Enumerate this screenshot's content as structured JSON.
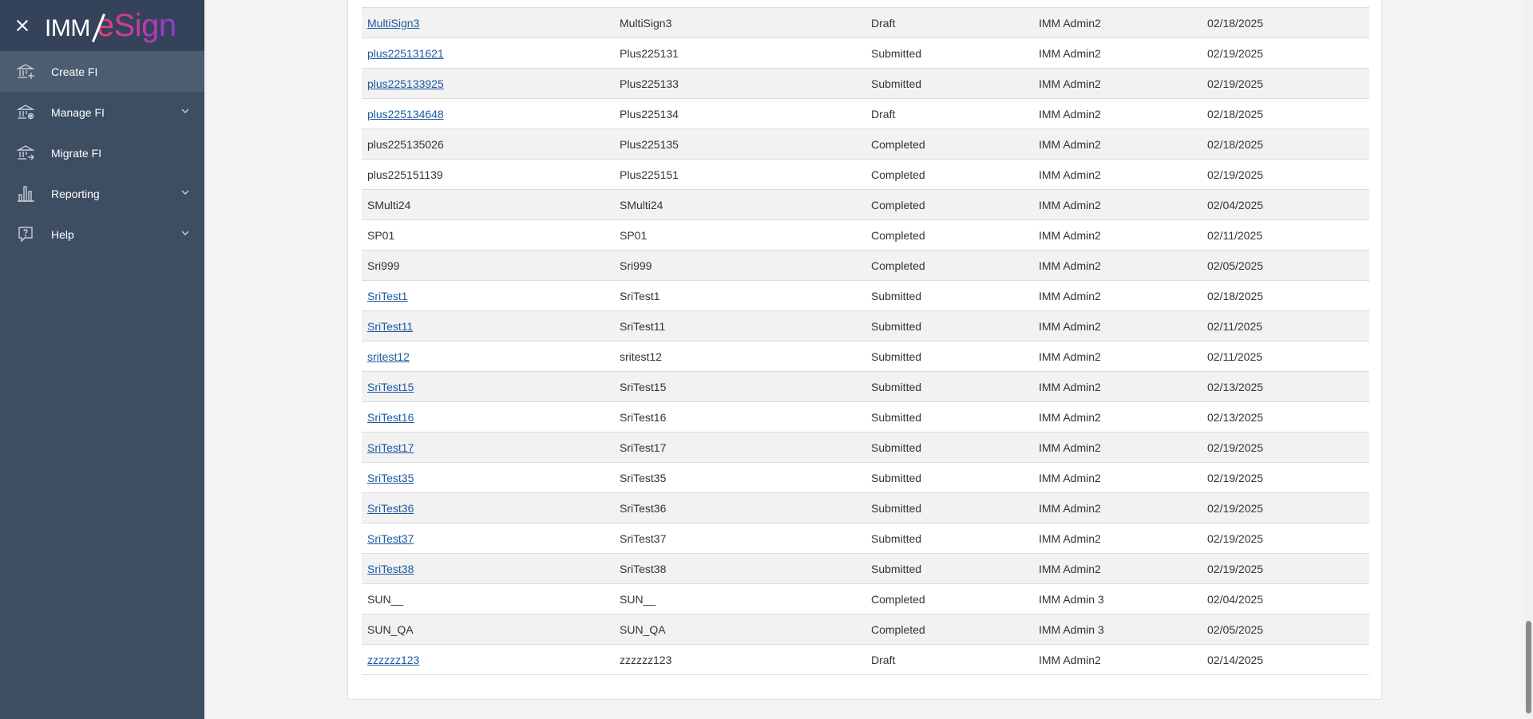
{
  "app": {
    "logo_prefix": "IMM",
    "logo_suffix": "eSign"
  },
  "sidebar": {
    "items": [
      {
        "label": "Create FI",
        "icon": "bank-plus-icon",
        "has_chevron": false,
        "active": true
      },
      {
        "label": "Manage FI",
        "icon": "bank-gear-icon",
        "has_chevron": true,
        "active": false
      },
      {
        "label": "Migrate FI",
        "icon": "bank-arrow-icon",
        "has_chevron": false,
        "active": false
      },
      {
        "label": "Reporting",
        "icon": "bar-chart-icon",
        "has_chevron": true,
        "active": false
      },
      {
        "label": "Help",
        "icon": "help-icon",
        "has_chevron": true,
        "active": false
      }
    ]
  },
  "table": {
    "rows": [
      {
        "name": "MultiSign3",
        "linked": true,
        "title": "MultiSign3",
        "status": "Draft",
        "owner": "IMM Admin2",
        "date": "02/18/2025"
      },
      {
        "name": "plus225131621",
        "linked": true,
        "title": "Plus225131",
        "status": "Submitted",
        "owner": "IMM Admin2",
        "date": "02/19/2025"
      },
      {
        "name": "plus225133925",
        "linked": true,
        "title": "Plus225133",
        "status": "Submitted",
        "owner": "IMM Admin2",
        "date": "02/19/2025"
      },
      {
        "name": "plus225134648",
        "linked": true,
        "title": "Plus225134",
        "status": "Draft",
        "owner": "IMM Admin2",
        "date": "02/18/2025"
      },
      {
        "name": "plus225135026",
        "linked": false,
        "title": "Plus225135",
        "status": "Completed",
        "owner": "IMM Admin2",
        "date": "02/18/2025"
      },
      {
        "name": "plus225151139",
        "linked": false,
        "title": "Plus225151",
        "status": "Completed",
        "owner": "IMM Admin2",
        "date": "02/19/2025"
      },
      {
        "name": "SMulti24",
        "linked": false,
        "title": "SMulti24",
        "status": "Completed",
        "owner": "IMM Admin2",
        "date": "02/04/2025"
      },
      {
        "name": "SP01",
        "linked": false,
        "title": "SP01",
        "status": "Completed",
        "owner": "IMM Admin2",
        "date": "02/11/2025"
      },
      {
        "name": "Sri999",
        "linked": false,
        "title": "Sri999",
        "status": "Completed",
        "owner": "IMM Admin2",
        "date": "02/05/2025"
      },
      {
        "name": "SriTest1",
        "linked": true,
        "title": "SriTest1",
        "status": "Submitted",
        "owner": "IMM Admin2",
        "date": "02/18/2025"
      },
      {
        "name": "SriTest11",
        "linked": true,
        "title": "SriTest11",
        "status": "Submitted",
        "owner": "IMM Admin2",
        "date": "02/11/2025"
      },
      {
        "name": "sritest12",
        "linked": true,
        "title": "sritest12",
        "status": "Submitted",
        "owner": "IMM Admin2",
        "date": "02/11/2025"
      },
      {
        "name": "SriTest15",
        "linked": true,
        "title": "SriTest15",
        "status": "Submitted",
        "owner": "IMM Admin2",
        "date": "02/13/2025"
      },
      {
        "name": "SriTest16",
        "linked": true,
        "title": "SriTest16",
        "status": "Submitted",
        "owner": "IMM Admin2",
        "date": "02/13/2025"
      },
      {
        "name": "SriTest17",
        "linked": true,
        "title": "SriTest17",
        "status": "Submitted",
        "owner": "IMM Admin2",
        "date": "02/19/2025"
      },
      {
        "name": "SriTest35",
        "linked": true,
        "title": "SriTest35",
        "status": "Submitted",
        "owner": "IMM Admin2",
        "date": "02/19/2025"
      },
      {
        "name": "SriTest36",
        "linked": true,
        "title": "SriTest36",
        "status": "Submitted",
        "owner": "IMM Admin2",
        "date": "02/19/2025"
      },
      {
        "name": "SriTest37",
        "linked": true,
        "title": "SriTest37",
        "status": "Submitted",
        "owner": "IMM Admin2",
        "date": "02/19/2025"
      },
      {
        "name": "SriTest38",
        "linked": true,
        "title": "SriTest38",
        "status": "Submitted",
        "owner": "IMM Admin2",
        "date": "02/19/2025"
      },
      {
        "name": "SUN__",
        "linked": false,
        "title": "SUN__",
        "status": "Completed",
        "owner": "IMM Admin 3",
        "date": "02/04/2025"
      },
      {
        "name": "SUN_QA",
        "linked": false,
        "title": "SUN_QA",
        "status": "Completed",
        "owner": "IMM Admin 3",
        "date": "02/05/2025"
      },
      {
        "name": "zzzzzz123",
        "linked": true,
        "title": "zzzzzz123",
        "status": "Draft",
        "owner": "IMM Admin2",
        "date": "02/14/2025"
      }
    ]
  },
  "colors": {
    "sidebar_bg": "#3d4d62",
    "sidebar_header_bg": "#34435a",
    "active_item_bg": "#4c5c71",
    "link": "#1b5aa0",
    "logo_gradient": [
      "#e83e7a",
      "#8a3fd1"
    ]
  }
}
